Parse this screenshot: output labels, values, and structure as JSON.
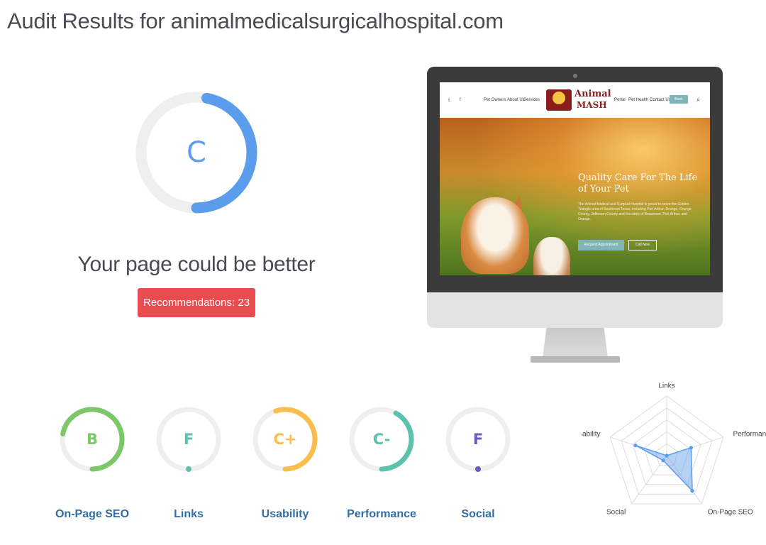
{
  "page": {
    "title": "Audit Results for animalmedicalsurgicalhospital.com"
  },
  "overall": {
    "grade": "C",
    "grade_fraction": 0.47,
    "color": "#5b9cec",
    "track_color": "#efefef",
    "verdict": "Your page could be better",
    "recommendations_label": "Recommendations: 23",
    "button_color": "#e84c50"
  },
  "preview": {
    "nav_items": [
      "Pet Owners",
      "About Us",
      "Services",
      "Portal",
      "Pet Health",
      "Contact Us"
    ],
    "cta": "Book Online",
    "logo_line1": "Animal",
    "logo_line2": "MASH",
    "hero_heading_line1": "Quality Care For The Life",
    "hero_heading_line2": "of Your Pet",
    "hero_text": "The Animal Medical and Surgical Hospital is proud to serve the Golden Triangle area of Southeast Texas, including Port Arthur, Orange, Orange County, Jefferson County and the cities of Beaumont, Port Arthur, and Orange.",
    "hero_button_primary": "Request Appointment",
    "hero_button_secondary": "Call Now"
  },
  "categories": [
    {
      "label": "On-Page SEO",
      "grade": "B",
      "fraction": 0.72,
      "color": "#7cc767"
    },
    {
      "label": "Links",
      "grade": "F",
      "fraction": 0.0,
      "color": "#5cc2ad"
    },
    {
      "label": "Usability",
      "grade": "C+",
      "fraction": 0.55,
      "color": "#f9be4e"
    },
    {
      "label": "Performance",
      "grade": "C-",
      "fraction": 0.42,
      "color": "#5cc2ad"
    },
    {
      "label": "Social",
      "grade": "F",
      "fraction": 0.0,
      "color": "#6c5bc4"
    }
  ],
  "chart_data": {
    "type": "radar",
    "axes": [
      "Links",
      "Performance",
      "On-Page SEO",
      "Social",
      "Usability"
    ],
    "range": [
      0,
      100
    ],
    "rings": 5,
    "series": [
      {
        "values": [
          0,
          43,
          73,
          10,
          55
        ],
        "color": "#5b9cec",
        "fill": "rgba(91,156,236,0.45)"
      }
    ],
    "grid": true
  }
}
